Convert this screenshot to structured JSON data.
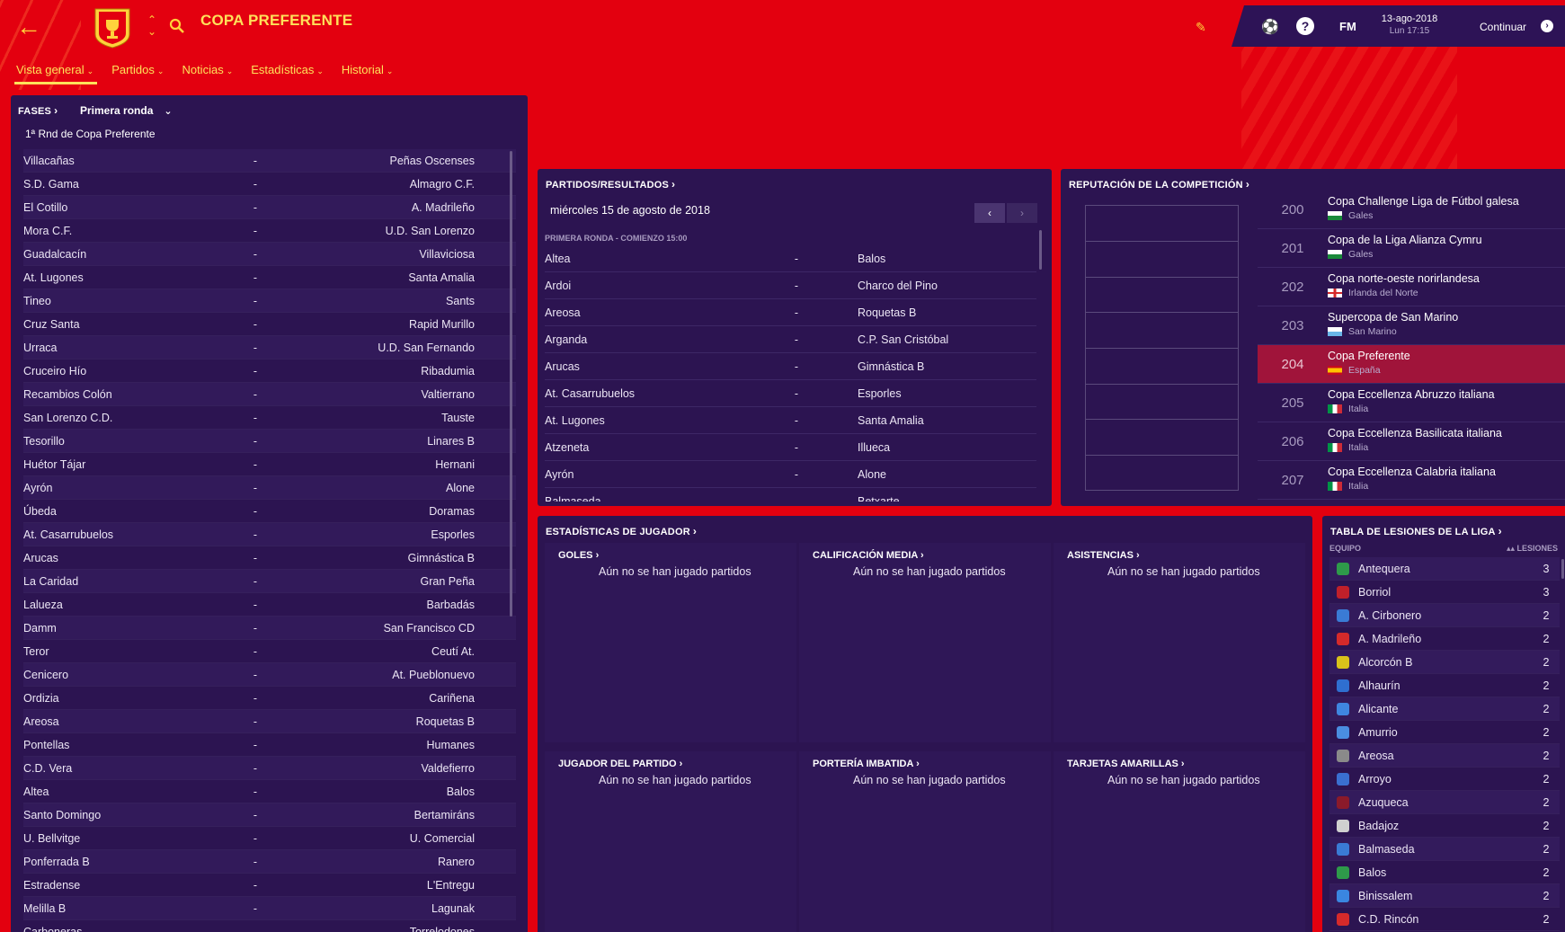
{
  "header": {
    "title": "COPA PREFERENTE",
    "topbar": {
      "fm_label": "FM",
      "help_label": "?",
      "date": "13-ago-2018",
      "time": "Lun 17:15",
      "continue_label": "Continuar"
    }
  },
  "nav": {
    "tabs": [
      {
        "label": "Vista general"
      },
      {
        "label": "Partidos"
      },
      {
        "label": "Noticias"
      },
      {
        "label": "Estadísticas"
      },
      {
        "label": "Historial"
      }
    ]
  },
  "fases": {
    "header": "FASES",
    "selected_round": "Primera ronda",
    "round_title": "1ª Rnd de Copa Preferente",
    "separator": "-",
    "fixtures": [
      {
        "home": "Villacañas",
        "away": "Peñas Oscenses"
      },
      {
        "home": "S.D. Gama",
        "away": "Almagro C.F."
      },
      {
        "home": "El Cotillo",
        "away": "A. Madrileño"
      },
      {
        "home": "Mora C.F.",
        "away": "U.D. San Lorenzo"
      },
      {
        "home": "Guadalcacín",
        "away": "Villaviciosa"
      },
      {
        "home": "At. Lugones",
        "away": "Santa Amalia"
      },
      {
        "home": "Tineo",
        "away": "Sants"
      },
      {
        "home": "Cruz Santa",
        "away": "Rapid Murillo"
      },
      {
        "home": "Urraca",
        "away": "U.D. San Fernando"
      },
      {
        "home": "Cruceiro Hío",
        "away": "Ribadumia"
      },
      {
        "home": "Recambios Colón",
        "away": "Valtierrano"
      },
      {
        "home": "San Lorenzo C.D.",
        "away": "Tauste"
      },
      {
        "home": "Tesorillo",
        "away": "Linares B"
      },
      {
        "home": "Huétor Tájar",
        "away": "Hernani"
      },
      {
        "home": "Ayrón",
        "away": "Alone"
      },
      {
        "home": "Úbeda",
        "away": "Doramas"
      },
      {
        "home": "At. Casarrubuelos",
        "away": "Esporles"
      },
      {
        "home": "Arucas",
        "away": "Gimnástica B"
      },
      {
        "home": "La Caridad",
        "away": "Gran Peña"
      },
      {
        "home": "Lalueza",
        "away": "Barbadás"
      },
      {
        "home": "Damm",
        "away": "San Francisco CD"
      },
      {
        "home": "Teror",
        "away": "Ceutí At."
      },
      {
        "home": "Cenicero",
        "away": "At. Pueblonuevo"
      },
      {
        "home": "Ordizia",
        "away": "Cariñena"
      },
      {
        "home": "Areosa",
        "away": "Roquetas B"
      },
      {
        "home": "Pontellas",
        "away": "Humanes"
      },
      {
        "home": "C.D. Vera",
        "away": "Valdefierro"
      },
      {
        "home": "Altea",
        "away": "Balos"
      },
      {
        "home": "Santo Domingo",
        "away": "Bertamiráns"
      },
      {
        "home": "U. Bellvitge",
        "away": "U. Comercial"
      },
      {
        "home": "Ponferrada B",
        "away": "Ranero"
      },
      {
        "home": "Estradense",
        "away": "L'Entregu"
      },
      {
        "home": "Melilla B",
        "away": "Lagunak"
      },
      {
        "home": "Carboneras",
        "away": "Torrelodones"
      }
    ]
  },
  "partidos": {
    "header": "PARTIDOS/RESULTADOS",
    "date": "miércoles 15 de agosto de 2018",
    "subheader": "PRIMERA RONDA - COMIENZO 15:00",
    "separator": "-",
    "matches": [
      {
        "home": "Altea",
        "away": "Balos"
      },
      {
        "home": "Ardoi",
        "away": "Charco del Pino"
      },
      {
        "home": "Areosa",
        "away": "Roquetas B"
      },
      {
        "home": "Arganda",
        "away": "C.P. San Cristóbal"
      },
      {
        "home": "Arucas",
        "away": "Gimnástica B"
      },
      {
        "home": "At. Casarrubuelos",
        "away": "Esporles"
      },
      {
        "home": "At. Lugones",
        "away": "Santa Amalia"
      },
      {
        "home": "Atzeneta",
        "away": "Illueca"
      },
      {
        "home": "Ayrón",
        "away": "Alone"
      },
      {
        "home": "Balmaseda",
        "away": "Betxarte"
      }
    ]
  },
  "reputacion": {
    "header": "REPUTACIÓN DE LA COMPETICIÓN",
    "items": [
      {
        "rank": "200",
        "name": "Copa Challenge Liga de Fútbol galesa",
        "country": "Gales",
        "flag": "wales"
      },
      {
        "rank": "201",
        "name": "Copa de la Liga Alianza Cymru",
        "country": "Gales",
        "flag": "wales"
      },
      {
        "rank": "202",
        "name": "Copa norte-oeste norirlandesa",
        "country": "Irlanda del Norte",
        "flag": "nireland"
      },
      {
        "rank": "203",
        "name": "Supercopa de San Marino",
        "country": "San Marino",
        "flag": "sanmarino"
      },
      {
        "rank": "204",
        "name": "Copa Preferente",
        "country": "España",
        "flag": "spain",
        "highlight": true
      },
      {
        "rank": "205",
        "name": "Copa Eccellenza Abruzzo italiana",
        "country": "Italia",
        "flag": "italy"
      },
      {
        "rank": "206",
        "name": "Copa Eccellenza Basilicata italiana",
        "country": "Italia",
        "flag": "italy"
      },
      {
        "rank": "207",
        "name": "Copa Eccellenza Calabria italiana",
        "country": "Italia",
        "flag": "italy"
      }
    ]
  },
  "estadisticas": {
    "header": "ESTADÍSTICAS DE JUGADOR",
    "boxes": [
      {
        "title": "GOLES",
        "body": "Aún no se han jugado partidos"
      },
      {
        "title": "CALIFICACIÓN MEDIA",
        "body": "Aún no se han jugado partidos"
      },
      {
        "title": "ASISTENCIAS",
        "body": "Aún no se han jugado partidos"
      },
      {
        "title": "JUGADOR DEL PARTIDO",
        "body": "Aún no se han jugado partidos"
      },
      {
        "title": "PORTERÍA IMBATIDA",
        "body": "Aún no se han jugado partidos"
      },
      {
        "title": "TARJETAS AMARILLAS",
        "body": "Aún no se han jugado partidos"
      }
    ]
  },
  "lesiones": {
    "header": "TABLA DE LESIONES DE LA LIGA",
    "col_team": "EQUIPO",
    "col_injuries": "LESIONES",
    "rows": [
      {
        "team": "Antequera",
        "value": "3",
        "crest": "#2e9a4a"
      },
      {
        "team": "Borriol",
        "value": "3",
        "crest": "#c0202a"
      },
      {
        "team": "A. Cirbonero",
        "value": "2",
        "crest": "#3a7bd5"
      },
      {
        "team": "A. Madrileño",
        "value": "2",
        "crest": "#d42a2a"
      },
      {
        "team": "Alcorcón B",
        "value": "2",
        "crest": "#d9c21a"
      },
      {
        "team": "Alhaurín",
        "value": "2",
        "crest": "#2f6fd0"
      },
      {
        "team": "Alicante",
        "value": "2",
        "crest": "#3f86e0"
      },
      {
        "team": "Amurrio",
        "value": "2",
        "crest": "#4a8de0"
      },
      {
        "team": "Areosa",
        "value": "2",
        "crest": "#8a8a8a"
      },
      {
        "team": "Arroyo",
        "value": "2",
        "crest": "#3a6fd0"
      },
      {
        "team": "Azuqueca",
        "value": "2",
        "crest": "#8a1a2a"
      },
      {
        "team": "Badajoz",
        "value": "2",
        "crest": "#d0d0d0"
      },
      {
        "team": "Balmaseda",
        "value": "2",
        "crest": "#3a7bd5"
      },
      {
        "team": "Balos",
        "value": "2",
        "crest": "#2e9a4a"
      },
      {
        "team": "Binissalem",
        "value": "2",
        "crest": "#3a86e0"
      },
      {
        "team": "C.D. Rincón",
        "value": "2",
        "crest": "#d42a2a"
      }
    ]
  },
  "colors": {
    "background": "#e3000f",
    "panel": "#2c1451",
    "accent": "#ffe15a",
    "highlight": "#a0143a"
  }
}
